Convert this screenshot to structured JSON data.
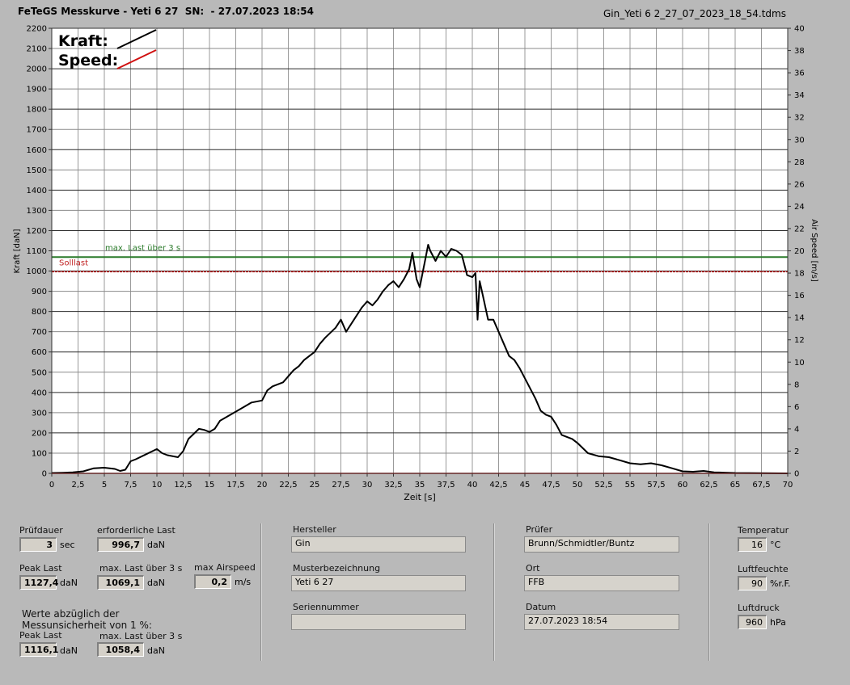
{
  "header": {
    "title": "FeTeGS Messkurve - Yeti 6 27  SN:  - 27.07.2023 18:54",
    "file": "Gin_Yeti 6 2_27_07_2023_18_54.tdms"
  },
  "chart_data": {
    "type": "line",
    "xlabel": "Zeit [s]",
    "ylabel": "Kraft [daN]",
    "y2label": "Air Speed [m/s]",
    "xlim": [
      0,
      70
    ],
    "ylim": [
      0,
      2200
    ],
    "y2lim": [
      0,
      40
    ],
    "xticks": [
      "0",
      "2,5",
      "5",
      "7,5",
      "10",
      "12,5",
      "15",
      "17,5",
      "20",
      "22,5",
      "25",
      "27,5",
      "30",
      "32,5",
      "35",
      "37,5",
      "40",
      "42,5",
      "45",
      "47,5",
      "50",
      "52,5",
      "55",
      "57,5",
      "60",
      "62,5",
      "65",
      "67,5",
      "70"
    ],
    "yticks": [
      "0",
      "100",
      "200",
      "300",
      "400",
      "500",
      "600",
      "700",
      "800",
      "900",
      "1000",
      "1100",
      "1200",
      "1300",
      "1400",
      "1500",
      "1600",
      "1700",
      "1800",
      "1900",
      "2000",
      "2100",
      "2200"
    ],
    "y2ticks": [
      "0",
      "2",
      "4",
      "6",
      "8",
      "10",
      "12",
      "14",
      "16",
      "18",
      "20",
      "22",
      "24",
      "26",
      "28",
      "30",
      "32",
      "34",
      "36",
      "38",
      "40"
    ],
    "legend": [
      {
        "name": "Kraft:",
        "color": "#000000"
      },
      {
        "name": "Speed:",
        "color": "#d01010"
      }
    ],
    "reference_lines": [
      {
        "label": "max. Last über  3 s",
        "y": 1069.1,
        "color": "#2a7a2a"
      },
      {
        "label": "Solllast",
        "y": 996.7,
        "color": "#c02020"
      }
    ],
    "series": [
      {
        "name": "Kraft:",
        "color": "#000000",
        "points": [
          [
            0,
            2
          ],
          [
            1,
            3
          ],
          [
            2,
            5
          ],
          [
            3,
            10
          ],
          [
            4,
            25
          ],
          [
            5,
            28
          ],
          [
            6,
            22
          ],
          [
            6.5,
            12
          ],
          [
            7,
            18
          ],
          [
            7.5,
            60
          ],
          [
            8,
            70
          ],
          [
            9,
            95
          ],
          [
            10,
            120
          ],
          [
            10.5,
            100
          ],
          [
            11,
            90
          ],
          [
            12,
            80
          ],
          [
            12.5,
            110
          ],
          [
            13,
            170
          ],
          [
            14,
            220
          ],
          [
            14.5,
            215
          ],
          [
            15,
            205
          ],
          [
            15.5,
            220
          ],
          [
            16,
            260
          ],
          [
            17,
            290
          ],
          [
            18,
            320
          ],
          [
            19,
            350
          ],
          [
            20,
            360
          ],
          [
            20.5,
            410
          ],
          [
            21,
            430
          ],
          [
            22,
            450
          ],
          [
            22.5,
            480
          ],
          [
            23,
            510
          ],
          [
            23.5,
            530
          ],
          [
            24,
            560
          ],
          [
            24.5,
            580
          ],
          [
            25,
            600
          ],
          [
            25.5,
            640
          ],
          [
            26,
            670
          ],
          [
            27,
            720
          ],
          [
            27.5,
            760
          ],
          [
            28,
            700
          ],
          [
            29,
            780
          ],
          [
            29.5,
            820
          ],
          [
            30,
            850
          ],
          [
            30.5,
            830
          ],
          [
            31,
            860
          ],
          [
            31.5,
            900
          ],
          [
            32,
            930
          ],
          [
            32.5,
            950
          ],
          [
            33,
            920
          ],
          [
            33.5,
            960
          ],
          [
            34,
            1010
          ],
          [
            34.3,
            1090
          ],
          [
            34.7,
            960
          ],
          [
            35,
            920
          ],
          [
            35.5,
            1050
          ],
          [
            35.8,
            1130
          ],
          [
            36,
            1100
          ],
          [
            36.5,
            1050
          ],
          [
            37,
            1100
          ],
          [
            37.5,
            1070
          ],
          [
            38,
            1110
          ],
          [
            38.5,
            1100
          ],
          [
            39,
            1080
          ],
          [
            39.5,
            980
          ],
          [
            40,
            970
          ],
          [
            40.3,
            990
          ],
          [
            40.5,
            760
          ],
          [
            40.7,
            950
          ],
          [
            41,
            880
          ],
          [
            41.5,
            760
          ],
          [
            42,
            760
          ],
          [
            42.5,
            700
          ],
          [
            43,
            640
          ],
          [
            43.5,
            580
          ],
          [
            44,
            560
          ],
          [
            44.5,
            520
          ],
          [
            45,
            470
          ],
          [
            45.5,
            420
          ],
          [
            46,
            370
          ],
          [
            46.5,
            310
          ],
          [
            47,
            290
          ],
          [
            47.5,
            280
          ],
          [
            48,
            240
          ],
          [
            48.5,
            190
          ],
          [
            49,
            180
          ],
          [
            49.5,
            170
          ],
          [
            50,
            150
          ],
          [
            51,
            100
          ],
          [
            52,
            85
          ],
          [
            53,
            80
          ],
          [
            54,
            65
          ],
          [
            55,
            50
          ],
          [
            56,
            45
          ],
          [
            57,
            50
          ],
          [
            58,
            40
          ],
          [
            59,
            25
          ],
          [
            60,
            10
          ],
          [
            61,
            8
          ],
          [
            62,
            12
          ],
          [
            63,
            5
          ],
          [
            65,
            2
          ],
          [
            70,
            0
          ]
        ]
      },
      {
        "name": "Speed:",
        "color": "#d01010",
        "points": [
          [
            0,
            0
          ],
          [
            70,
            0
          ]
        ]
      }
    ]
  },
  "panel": {
    "pruefdauer_label": "Prüfdauer",
    "pruefdauer_value": "3",
    "pruefdauer_unit": "sec",
    "erf_last_label": "erforderliche Last",
    "erf_last_value": "996,7",
    "erf_last_unit": "daN",
    "peak_label": "Peak Last",
    "peak_value": "1127,4",
    "peak_unit": "daN",
    "maxlast_label": "max. Last über  3 s",
    "maxlast_value": "1069,1",
    "maxlast_unit": "daN",
    "airspeed_label": "max Airspeed",
    "airspeed_value": "0,2",
    "airspeed_unit": "m/s",
    "note_line1": "Werte abzüglich der",
    "note_line2": "Messunsicherheit von 1  %:",
    "peak2_label": "Peak Last",
    "peak2_value": "1116,1",
    "peak2_unit": "daN",
    "maxlast2_label": "max. Last über  3 s",
    "maxlast2_value": "1058,4",
    "maxlast2_unit": "daN",
    "hersteller_label": "Hersteller",
    "hersteller_value": "Gin",
    "muster_label": "Musterbezeichnung",
    "muster_value": "Yeti 6 27",
    "serien_label": "Seriennummer",
    "serien_value": "",
    "pruefer_label": "Prüfer",
    "pruefer_value": "Brunn/Schmidtler/Buntz",
    "ort_label": "Ort",
    "ort_value": "FFB",
    "datum_label": "Datum",
    "datum_value": "27.07.2023 18:54",
    "temp_label": "Temperatur",
    "temp_value": "16",
    "temp_unit": "°C",
    "feuchte_label": "Luftfeuchte",
    "feuchte_value": "90",
    "feuchte_unit": "%r.F.",
    "druck_label": "Luftdruck",
    "druck_value": "960",
    "druck_unit": "hPa"
  }
}
